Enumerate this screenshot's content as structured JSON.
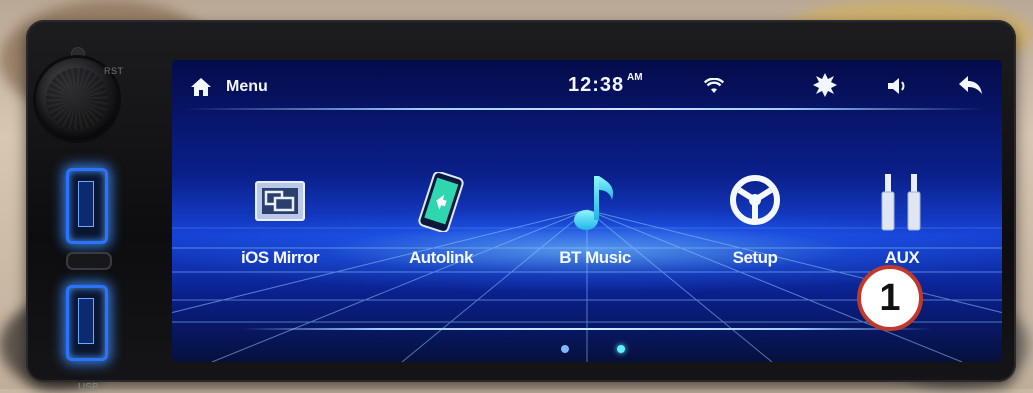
{
  "statusbar": {
    "menu_label": "Menu",
    "time": "12:38",
    "ampm": "AM",
    "icons": [
      "home-icon",
      "wifi-icon",
      "brightness-icon",
      "volume-icon",
      "back-icon"
    ]
  },
  "apps": [
    {
      "label": "iOS Mirror",
      "icon": "screen-mirror-icon"
    },
    {
      "label": "Autolink",
      "icon": "phone-link-icon"
    },
    {
      "label": "BT Music",
      "icon": "music-note-icon"
    },
    {
      "label": "Setup",
      "icon": "steering-wheel-icon"
    },
    {
      "label": "AUX",
      "icon": "aux-cable-icon"
    }
  ],
  "pager": {
    "pages": 2,
    "current": 2
  },
  "device": {
    "reset_label": "RST",
    "usb_label": "USB"
  },
  "callout": {
    "number": "1"
  },
  "colors": {
    "screen_top": "#050b4a",
    "screen_mid": "#1743d6",
    "accent": "#5ef0ff",
    "callout_border": "#c0392b"
  }
}
